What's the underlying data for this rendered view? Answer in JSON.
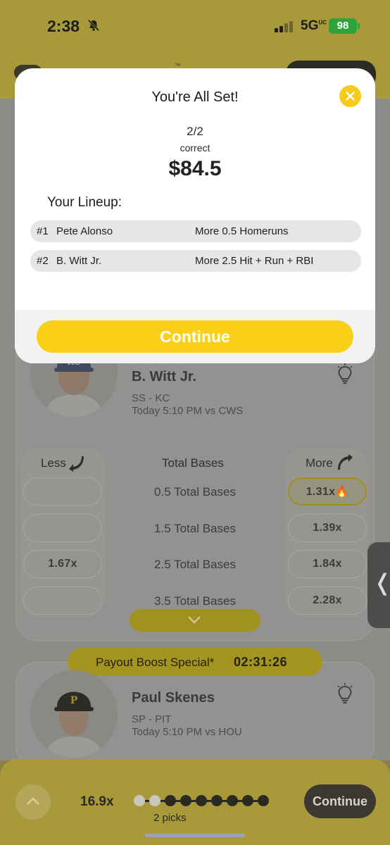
{
  "status_bar": {
    "time": "2:38",
    "network": "5G",
    "network_sup": "UC",
    "battery": "98"
  },
  "card1": {
    "player_name": "B. Witt Jr.",
    "position": "SS - KC",
    "game": "Today 5:10 PM vs CWS",
    "stat_title": "Total Bases",
    "less_label": "Less",
    "more_label": "More",
    "rows": [
      {
        "line": "0.5 Total Bases",
        "less": "",
        "more": "1.31x",
        "more_selected": true
      },
      {
        "line": "1.5 Total Bases",
        "less": "",
        "more": "1.39x"
      },
      {
        "line": "2.5 Total Bases",
        "less": "1.67x",
        "more": "1.84x"
      },
      {
        "line": "3.5 Total Bases",
        "less": "",
        "more": "2.28x"
      }
    ]
  },
  "boost": {
    "label": "Payout Boost Special*",
    "timer": "02:31:26"
  },
  "card2": {
    "player_name": "Paul Skenes",
    "position": "SP - PIT",
    "game": "Today 5:10 PM vs HOU"
  },
  "bottom_bar": {
    "multiplier": "16.9x",
    "picks": "2 picks",
    "continue_label": "Continue",
    "picks_count": 2,
    "dots_total": 9
  },
  "modal": {
    "title": "You're All Set!",
    "score": "2/2",
    "score_sub": "correct",
    "payout": "$84.5",
    "lineup_heading": "Your Lineup:",
    "lineup": [
      {
        "num": "#1",
        "player": "Pete Alonso",
        "pick": "More 0.5 Homeruns"
      },
      {
        "num": "#2",
        "player": "B. Witt Jr.",
        "pick": "More 2.5 Hit + Run + RBI"
      }
    ],
    "cta_label": "Continue"
  },
  "colors": {
    "accent": "#F9CF17",
    "overlay_brand": "#A89A3A",
    "modal_bg": "#FFFFFF"
  }
}
